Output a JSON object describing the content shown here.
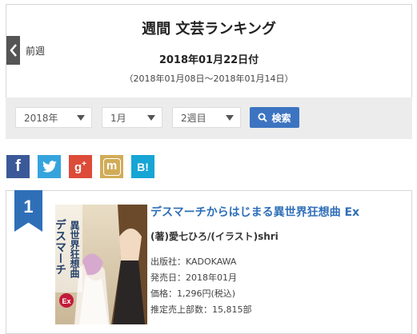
{
  "header": {
    "title": "週間 文芸ランキング",
    "date": "2018年01月22日付",
    "range": "（2018年01月08日～2018年01月14日）",
    "prev_label": "前週"
  },
  "filters": {
    "year": "2018年",
    "month": "1月",
    "week": "2週目",
    "search_label": "検索"
  },
  "social": [
    {
      "name": "facebook",
      "glyph": "f",
      "color": "#3b5998"
    },
    {
      "name": "twitter",
      "glyph": "t",
      "color": "#35a4dd"
    },
    {
      "name": "google-plus",
      "glyph": "g+",
      "color": "#dd4b39"
    },
    {
      "name": "mixi",
      "glyph": "m",
      "color": "#d1ac58"
    },
    {
      "name": "hatena",
      "glyph": "B!",
      "color": "#16a5d4"
    }
  ],
  "ranking": {
    "rank": "1",
    "title": "デスマーチからはじまる異世界狂想曲 Ex",
    "author": "(著)愛七ひろ/(イラスト)shri",
    "publisher": "出版社：KADOKAWA",
    "release": "発売日：2018年01月",
    "price": "価格：1,296円(税込)",
    "sales": "推定売上部数：15,815部",
    "cover_title": "デスマーチからはじまる異世界狂想曲",
    "cover_badge": "Ex"
  }
}
